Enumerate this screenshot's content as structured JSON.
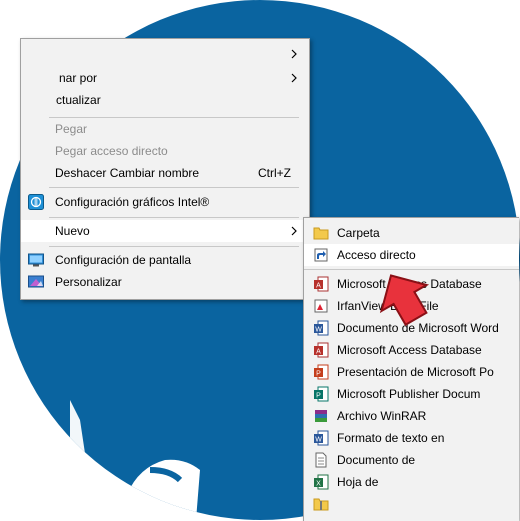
{
  "menu": {
    "items": [
      {
        "label": ""
      },
      {
        "label": "nar por"
      },
      {
        "label": "ctualizar"
      },
      {
        "label": "Pegar"
      },
      {
        "label": "Pegar acceso directo"
      },
      {
        "label": "Deshacer Cambiar nombre",
        "shortcut": "Ctrl+Z"
      },
      {
        "label": "Configuración gráficos Intel®"
      },
      {
        "label": "Nuevo"
      },
      {
        "label": "Configuración de pantalla"
      },
      {
        "label": "Personalizar"
      }
    ]
  },
  "submenu": {
    "items": [
      {
        "label": "Carpeta"
      },
      {
        "label": "Acceso directo"
      },
      {
        "label": "Microsoft Access Database"
      },
      {
        "label": "IrfanView BMP File"
      },
      {
        "label": "Documento de Microsoft Word"
      },
      {
        "label": "Microsoft Access Database"
      },
      {
        "label": "Presentación de Microsoft Po"
      },
      {
        "label": "Microsoft Publisher Docum"
      },
      {
        "label": "Archivo WinRAR"
      },
      {
        "label": "Formato de texto en"
      },
      {
        "label": "Documento de"
      },
      {
        "label": "Hoja de"
      },
      {
        "label": ""
      }
    ]
  },
  "colors": {
    "background": "#0a64a0",
    "menu": "#f2f2f2",
    "highlight": "#ffffff",
    "pointer": "#e8323c"
  }
}
